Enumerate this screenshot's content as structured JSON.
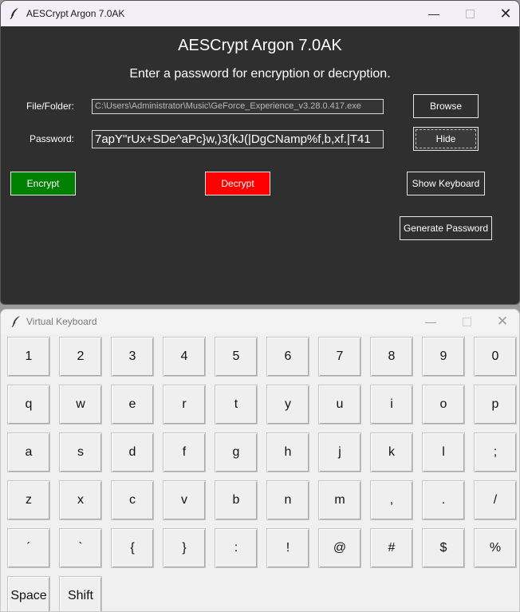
{
  "main_window": {
    "title": "AESCrypt Argon 7.0AK",
    "heading": "AESCrypt Argon 7.0AK",
    "prompt": "Enter a password for encryption or decryption.",
    "file_label": "File/Folder:",
    "file_path": "C:\\Users\\Administrator\\Music\\GeForce_Experience_v3.28.0.417.exe",
    "password_label": "Password:",
    "password_value": "7apY\"rUx+SDe^aPc}w,)3(kJ(|DgCNamp%f,b,xf.|T41",
    "browse_label": "Browse",
    "hide_label": "Hide",
    "encrypt_label": "Encrypt",
    "decrypt_label": "Decrypt",
    "show_keyboard_label": "Show Keyboard",
    "generate_password_label": "Generate Password",
    "colors": {
      "encrypt": "#008000",
      "decrypt": "#ff0000",
      "background": "#2f2f2f"
    }
  },
  "keyboard_window": {
    "title": "Virtual Keyboard",
    "rows": [
      [
        "1",
        "2",
        "3",
        "4",
        "5",
        "6",
        "7",
        "8",
        "9",
        "0"
      ],
      [
        "q",
        "w",
        "e",
        "r",
        "t",
        "y",
        "u",
        "i",
        "o",
        "p"
      ],
      [
        "a",
        "s",
        "d",
        "f",
        "g",
        "h",
        "j",
        "k",
        "l",
        ";"
      ],
      [
        "z",
        "x",
        "c",
        "v",
        "b",
        "n",
        "m",
        ",",
        ".",
        "/"
      ],
      [
        "´",
        "`",
        "{",
        "}",
        ":",
        "!",
        "@",
        "#",
        "$",
        "%"
      ],
      [
        "Space",
        "Shift"
      ]
    ]
  },
  "icons": {
    "app": "feather-icon",
    "minimize": "minimize-icon",
    "maximize": "maximize-icon",
    "close": "close-icon"
  }
}
